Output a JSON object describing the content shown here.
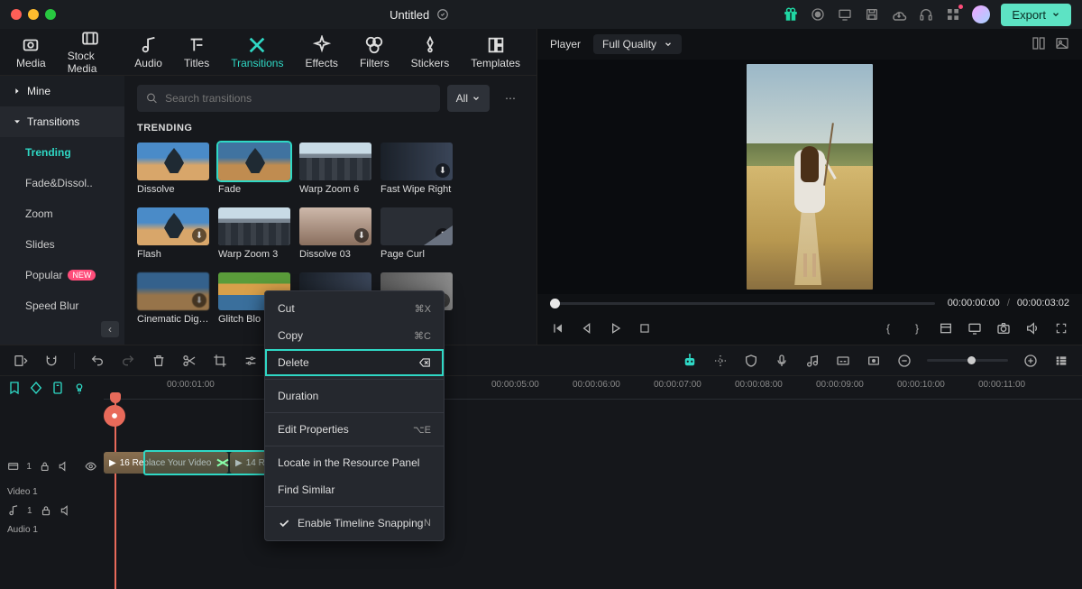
{
  "title": "Untitled",
  "export": "Export",
  "tabs": [
    "Media",
    "Stock Media",
    "Audio",
    "Titles",
    "Transitions",
    "Effects",
    "Filters",
    "Stickers",
    "Templates"
  ],
  "tabs_active": 4,
  "sidebar": {
    "mine": "Mine",
    "group": "Transitions",
    "items": [
      "Trending",
      "Fade&Dissol..",
      "Zoom",
      "Slides",
      "Popular",
      "Speed Blur"
    ],
    "active": 0,
    "new_badge": "NEW"
  },
  "search": {
    "placeholder": "Search transitions",
    "all": "All"
  },
  "section": "TRENDING",
  "cards": [
    {
      "label": "Dissolve",
      "thumb": "sky1"
    },
    {
      "label": "Fade",
      "thumb": "sky2",
      "selected": true
    },
    {
      "label": "Warp Zoom 6",
      "thumb": "city",
      "dl": true
    },
    {
      "label": "Fast Wipe Right",
      "thumb": "blur",
      "dl": true
    },
    {
      "label": ""
    },
    {
      "label": "Flash",
      "thumb": "sky1",
      "dl": true
    },
    {
      "label": "Warp Zoom 3",
      "thumb": "city",
      "dl": true
    },
    {
      "label": "Dissolve 03",
      "thumb": "blur soft",
      "dl": true
    },
    {
      "label": "Page Curl",
      "thumb": "pagecurl",
      "dl": true
    },
    {
      "label": ""
    },
    {
      "label": "Cinematic Digit…",
      "thumb": "cine",
      "dl": true
    },
    {
      "label": "Glitch Blo",
      "thumb": "glitch",
      "dl": true
    },
    {
      "label": "",
      "thumb": "blur",
      "dl": true
    },
    {
      "label": "",
      "thumb": "blur grey",
      "dl": true
    },
    {
      "label": ""
    }
  ],
  "player": {
    "label": "Player",
    "quality": "Full Quality",
    "time_cur": "00:00:00:00",
    "time_dur": "00:00:03:02"
  },
  "ruler": [
    "00:00:01:00",
    "00:00:05:00",
    "00:00:06:00",
    "00:00:07:00",
    "00:00:08:00",
    "00:00:09:00",
    "00:00:10:00",
    "00:00:11:00"
  ],
  "tracks": {
    "video": "Video 1",
    "audio": "Audio 1",
    "clip1": "16 Replace Your Video",
    "clip2": "14 R"
  },
  "ctx": {
    "cut": "Cut",
    "cut_sc": "⌘X",
    "copy": "Copy",
    "copy_sc": "⌘C",
    "delete": "Delete",
    "duration": "Duration",
    "edit": "Edit Properties",
    "edit_sc": "⌥E",
    "locate": "Locate in the Resource Panel",
    "similar": "Find Similar",
    "snap": "Enable Timeline Snapping",
    "snap_sc": "N"
  }
}
